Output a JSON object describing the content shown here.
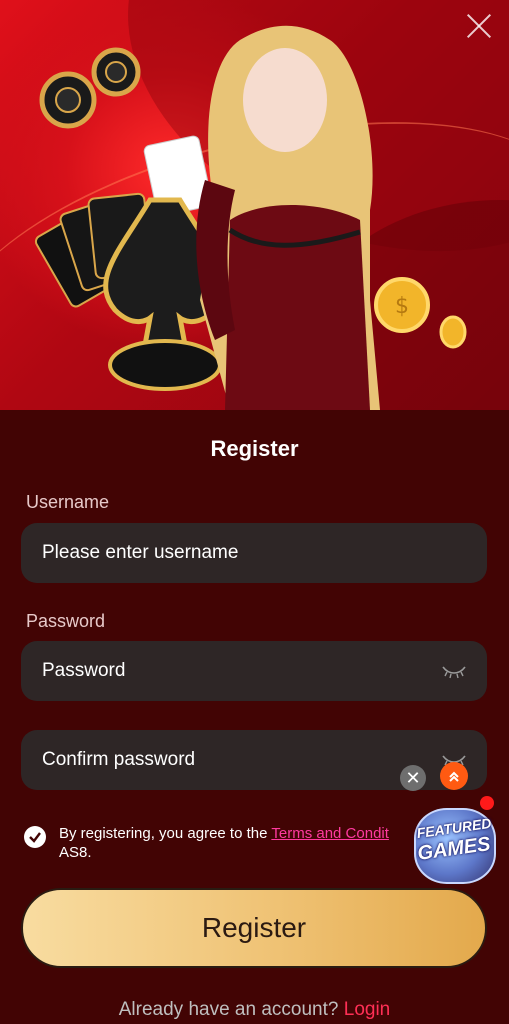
{
  "modal": {
    "close_label": "×"
  },
  "form": {
    "title": "Register",
    "username_label": "Username",
    "username_placeholder": "Please enter username",
    "password_label": "Password",
    "password_placeholder": "Password",
    "confirm_placeholder": "Confirm password",
    "agree_prefix": "By registering, you agree to the ",
    "terms_link": "Terms and Condit",
    "agree_suffix": " AS8.",
    "register_button": "Register",
    "have_account": "Already have an account? ",
    "login_link": "Login"
  },
  "widget": {
    "featured_line1": "FEATURED",
    "featured_line2": "GAMES"
  },
  "colors": {
    "accent": "#ff2f55",
    "terms": "#ff3aa0",
    "panel_bg": "#420404",
    "field_bg": "#2e2626",
    "button_gold": "#efc274"
  },
  "icons": [
    "close-icon",
    "eye-closed-icon",
    "checkbox-checked-icon",
    "chevron-up-icon"
  ]
}
